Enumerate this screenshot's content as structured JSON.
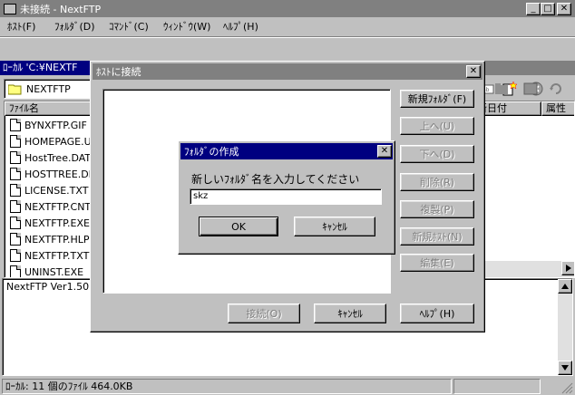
{
  "app": {
    "title": "未接続 - NextFTP",
    "menu": [
      "ﾎｽﾄ(F)",
      "ﾌｫﾙﾀﾞ(D)",
      "ｺﾏﾝﾄﾞ(C)",
      "ｳｨﾝﾄﾞｳ(W)",
      "ﾍﾙﾌﾟ(H)"
    ],
    "caption_buttons": {
      "minimize": "_",
      "maximize": "□",
      "close": "✕"
    }
  },
  "local_panel": {
    "title": "ﾛｰｶﾙ 'C:¥NEXTF",
    "folder": "NEXTFTP",
    "column_header": "ﾌｧｲﾙ名",
    "files": [
      "BYNXFTP.GIF",
      "HOMEPAGE.UI",
      "HostTree.DAT",
      "HOSTTREE.DE",
      "LICENSE.TXT",
      "NEXTFTP.CNT",
      "NEXTFTP.EXE",
      "NEXTFTP.HLP",
      "NEXTFTP.TXT",
      "UNINST.EXE"
    ]
  },
  "remote_panel": {
    "col_date": "新日付",
    "col_attr": "属性"
  },
  "log": {
    "text": "NextFTP Ver1.50"
  },
  "status_bar": {
    "text": "ﾛｰｶﾙ: 11 個のﾌｧｲﾙ  464.0KB"
  },
  "host_dialog": {
    "title": "ﾎｽﾄに接続",
    "close": "✕",
    "side_buttons": [
      {
        "label": "新規ﾌｫﾙﾀﾞ(F)",
        "enabled": true
      },
      {
        "label": "上へ(U)",
        "enabled": false
      },
      {
        "label": "下へ(D)",
        "enabled": false
      },
      {
        "label": "削除(R)",
        "enabled": false
      },
      {
        "label": "複製(P)",
        "enabled": false
      },
      {
        "label": "新規ﾎｽﾄ(N)",
        "enabled": false
      },
      {
        "label": "編集(E)",
        "enabled": false
      }
    ],
    "bottom_buttons": {
      "connect": "接続(O)",
      "cancel": "ｷｬﾝｾﾙ",
      "help": "ﾍﾙﾌﾟ(H)"
    }
  },
  "folder_dialog": {
    "title": "ﾌｫﾙﾀﾞの作成",
    "close": "✕",
    "prompt": "新しいﾌｫﾙﾀﾞ名を入力してください",
    "input_value": "skz",
    "ok_label": "OK",
    "cancel_label": "ｷｬﾝｾﾙ"
  },
  "colors": {
    "active_title": "#000080",
    "inactive_title": "#808080",
    "face": "#c0c0c0"
  }
}
